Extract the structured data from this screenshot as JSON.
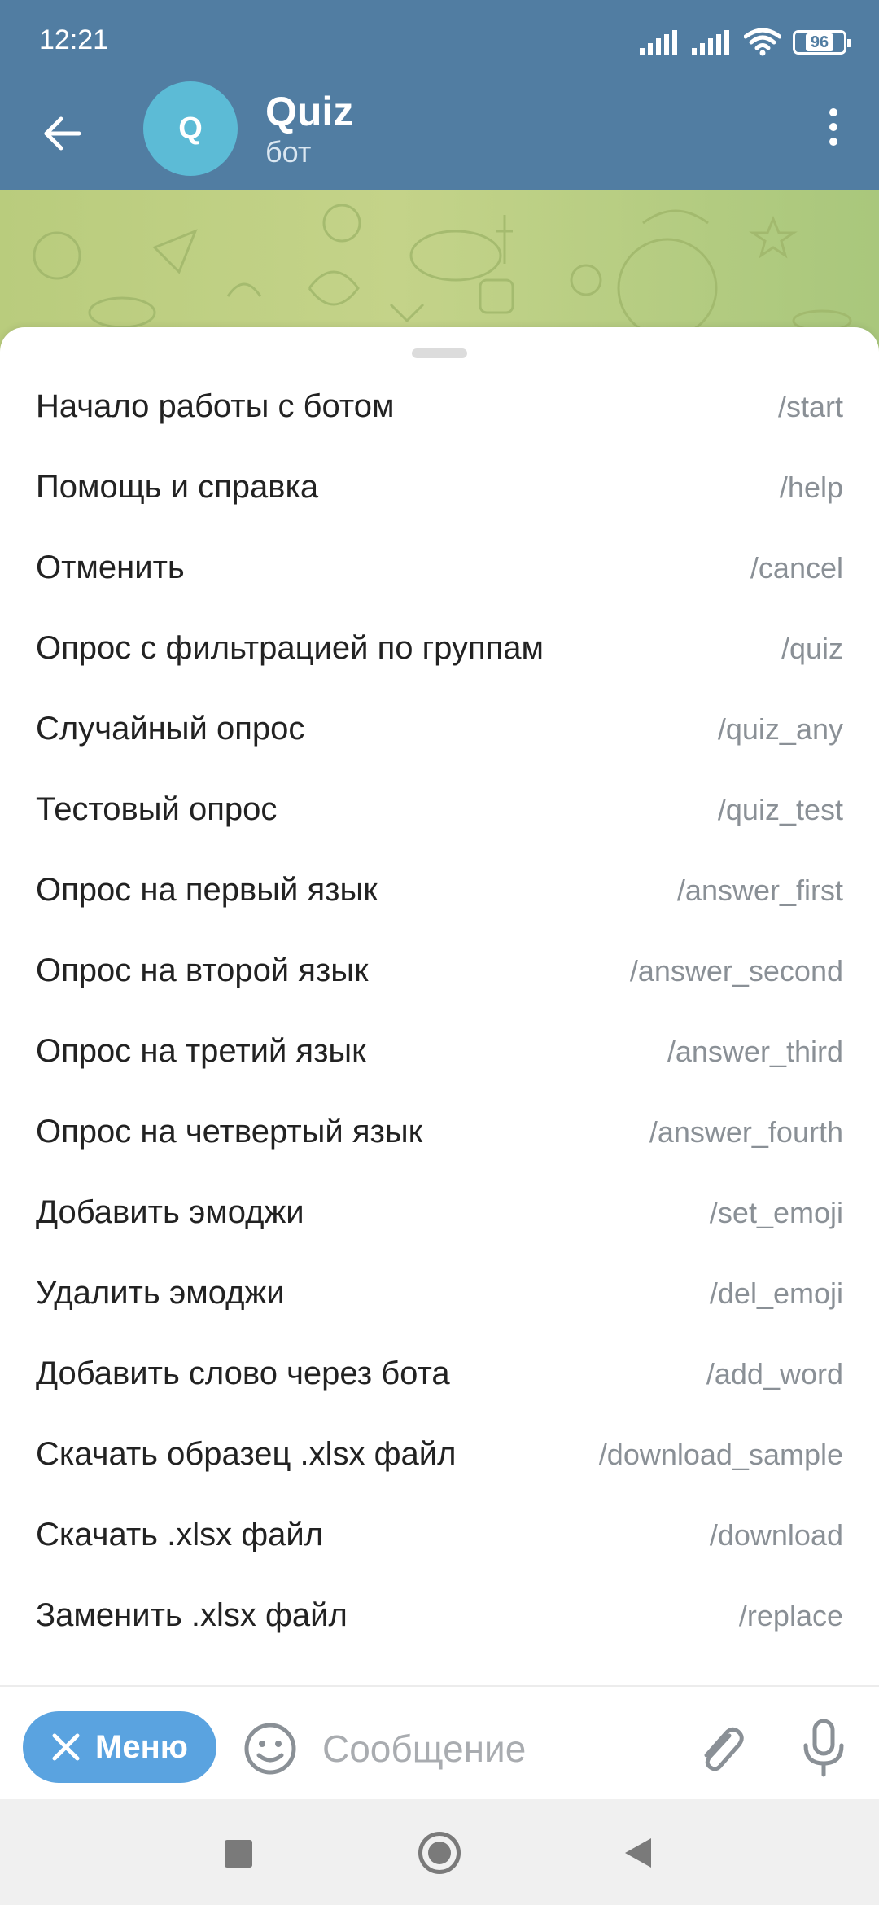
{
  "status_bar": {
    "time": "12:21",
    "battery": "96"
  },
  "header": {
    "avatar_letter": "Q",
    "title": "Quiz",
    "subtitle": "бот"
  },
  "commands": [
    {
      "description": "Начало работы с ботом",
      "command": "/start"
    },
    {
      "description": "Помощь и справка",
      "command": "/help"
    },
    {
      "description": "Отменить",
      "command": "/cancel"
    },
    {
      "description": "Опрос с фильтрацией по группам",
      "command": "/quiz"
    },
    {
      "description": "Случайный опрос",
      "command": "/quiz_any"
    },
    {
      "description": "Тестовый опрос",
      "command": "/quiz_test"
    },
    {
      "description": "Опрос на первый язык",
      "command": "/answer_first"
    },
    {
      "description": "Опрос на второй язык",
      "command": "/answer_second"
    },
    {
      "description": "Опрос на третий язык",
      "command": "/answer_third"
    },
    {
      "description": "Опрос на четвертый язык",
      "command": "/answer_fourth"
    },
    {
      "description": "Добавить эмоджи",
      "command": "/set_emoji"
    },
    {
      "description": "Удалить эмоджи",
      "command": "/del_emoji"
    },
    {
      "description": "Добавить слово через бота",
      "command": "/add_word"
    },
    {
      "description": "Скачать образец .xlsx файл",
      "command": "/download_sample"
    },
    {
      "description": "Скачать .xlsx файл",
      "command": "/download"
    },
    {
      "description": "Заменить .xlsx файл",
      "command": "/replace"
    }
  ],
  "input_bar": {
    "menu_label": "Меню",
    "message_placeholder": "Сообщение",
    "message_value": ""
  },
  "icons": {
    "back": "arrow-left-icon",
    "more": "more-vertical-icon",
    "menu_close": "close-icon",
    "emoji": "smile-icon",
    "attach": "paperclip-icon",
    "mic": "microphone-icon",
    "nav_recent": "square-icon",
    "nav_home": "circle-icon",
    "nav_back": "triangle-back-icon"
  },
  "colors": {
    "header": "#517da2",
    "avatar": "#5cbbd6",
    "menu_button": "#5aa3e0",
    "command_text": "#8a9096"
  }
}
